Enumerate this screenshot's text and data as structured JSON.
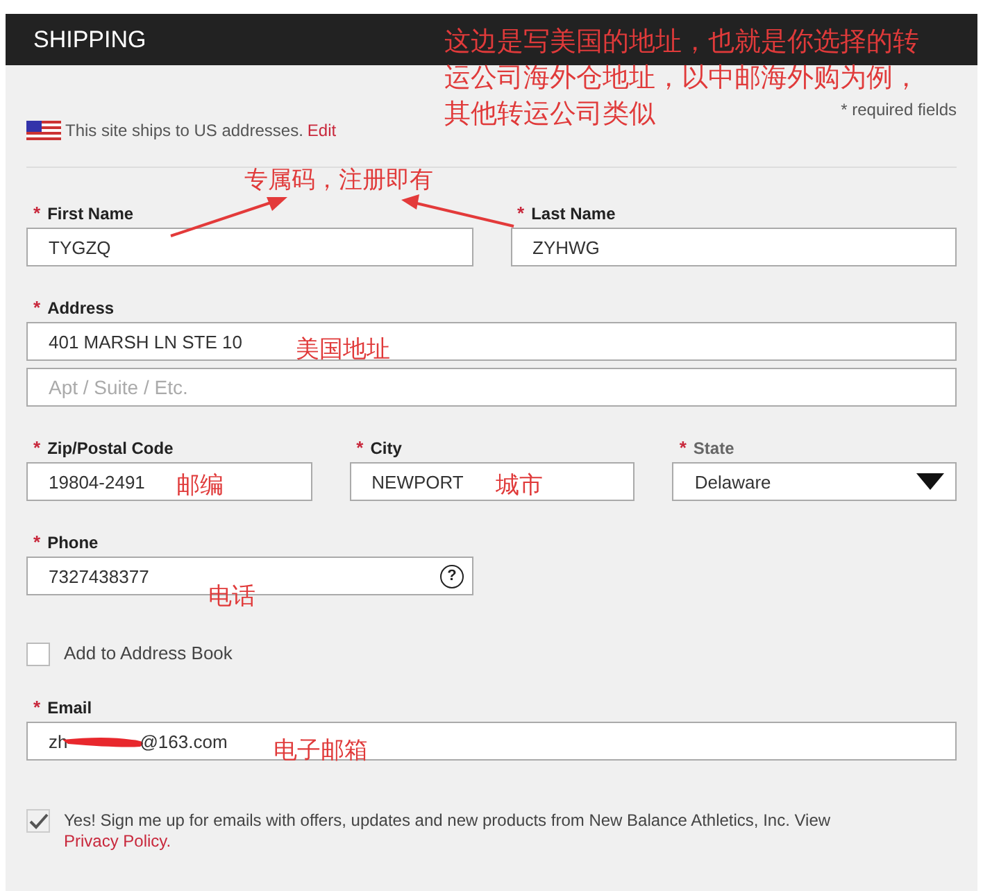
{
  "header": {
    "title": "SHIPPING"
  },
  "required_mark": "*",
  "required_note": "* required fields",
  "ships_note": {
    "text": "This site ships to US addresses.",
    "link": "Edit"
  },
  "name_row": [
    {
      "label": "First Name",
      "required": true,
      "value": "TYGZQ"
    },
    {
      "label": "Last Name",
      "required": true,
      "value": "ZYHWG"
    }
  ],
  "address": {
    "label": "Address",
    "required": true,
    "value": "401 MARSH LN STE 10",
    "line2_placeholder": "Apt / Suite / Etc."
  },
  "location_row": [
    {
      "kind": "text",
      "label": "Zip/Postal Code",
      "required": true,
      "value": "19804-2491"
    },
    {
      "kind": "text",
      "label": "City",
      "required": true,
      "value": "NEWPORT"
    },
    {
      "kind": "select",
      "label": "State",
      "required": true,
      "value": "Delaware"
    }
  ],
  "phone": {
    "label": "Phone",
    "required": true,
    "value": "7327438377",
    "help_icon": "?"
  },
  "address_book": {
    "label": "Add to Address Book",
    "checked": false
  },
  "email": {
    "label": "Email",
    "required": true,
    "value_start": "zh",
    "value_end": "@163.com"
  },
  "signup": {
    "checked": true,
    "text": "Yes! Sign me up for emails with offers, updates and new products from New Balance Athletics, Inc. View",
    "link": "Privacy Policy."
  },
  "annotations": {
    "top_note": [
      "这边是写美国的地址，也就是你选择的转",
      "运公司海外仓地址，以中邮海外购为例，",
      "其他转运公司类似"
    ],
    "code_note": "专属码，注册即有",
    "address_note": "美国地址",
    "zip_note": "邮编",
    "city_note": "城市",
    "phone_note": "电话",
    "email_note": "电子邮箱"
  }
}
